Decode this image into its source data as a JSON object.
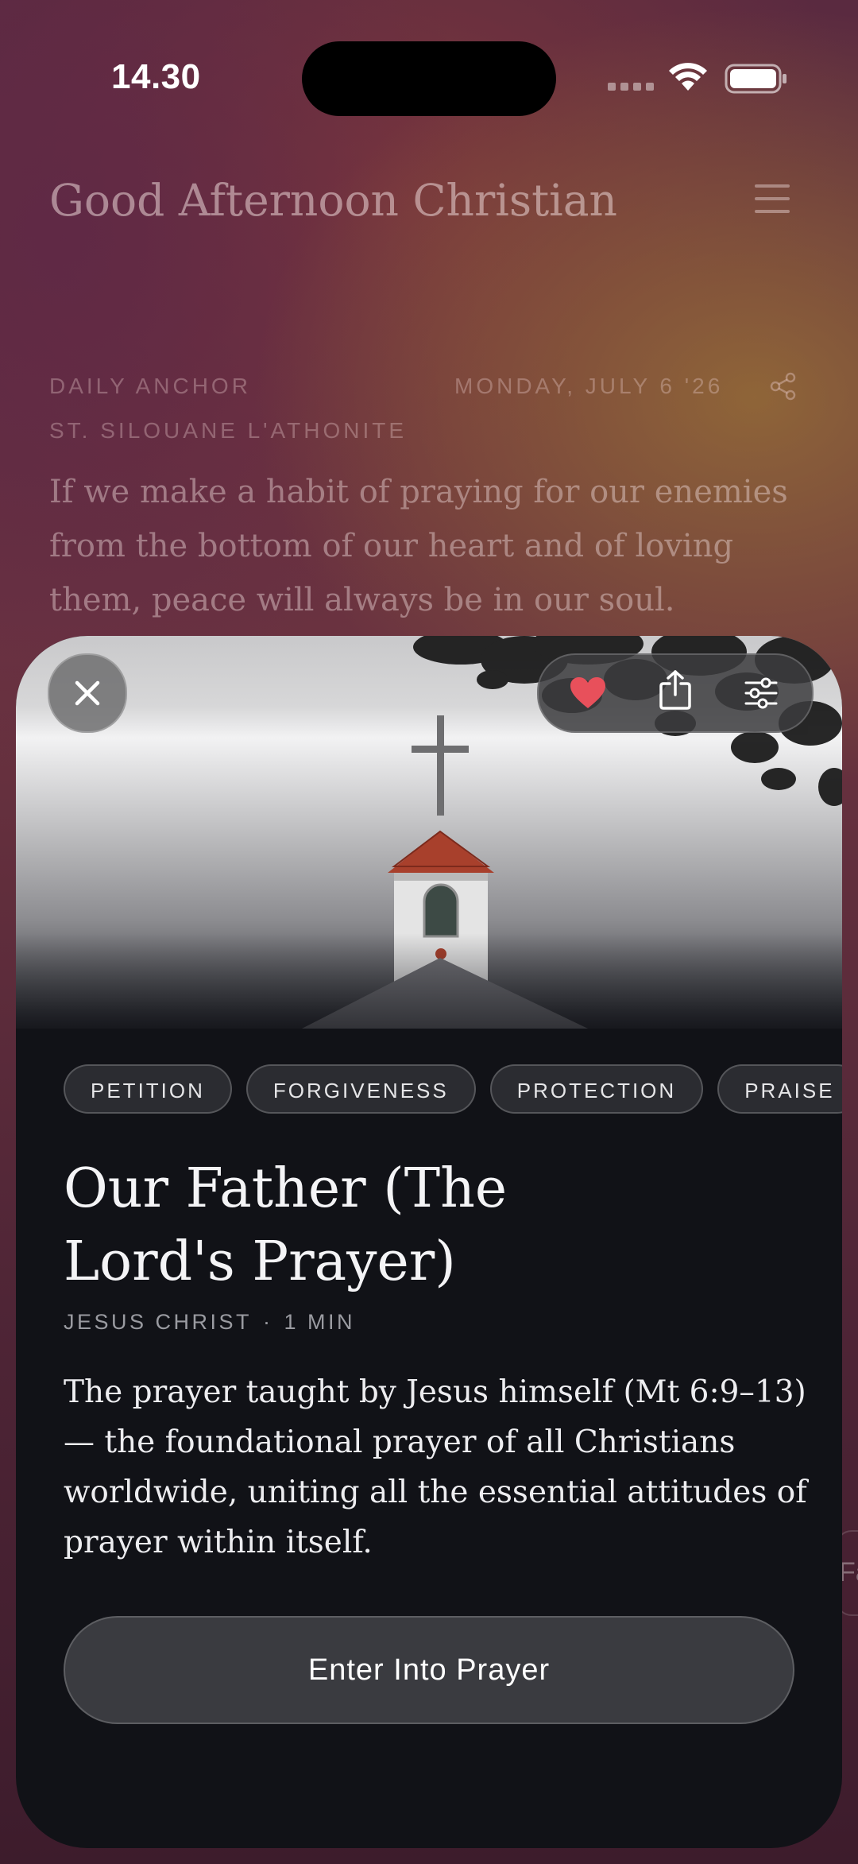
{
  "status_bar": {
    "time": "14.30"
  },
  "header": {
    "greeting": "Good Afternoon Christian"
  },
  "daily_anchor": {
    "label": "DAILY ANCHOR",
    "date": "MONDAY, JULY 6 '26",
    "author": "ST. SILOUANE L'ATHONITE",
    "quote": "If we make a habit of praying for our enemies from the bottom of our heart and of loving them, peace will always be in our soul."
  },
  "side_pill_text": "Fa",
  "prayer": {
    "tags": [
      "PETITION",
      "FORGIVENESS",
      "PROTECTION",
      "PRAISE"
    ],
    "title": "Our Father (The Lord's Prayer)",
    "author": "JESUS CHRIST",
    "separator": "·",
    "duration": "1 MIN",
    "description": "The prayer taught by Jesus himself (Mt 6:9–13) — the foundational prayer of all Christians worldwide, uniting all the essential attitudes of prayer within itself.",
    "cta_label": "Enter Into Prayer",
    "favorited": true
  },
  "icons": {
    "close": "close-icon",
    "favorite": "heart-icon",
    "share": "share-icon",
    "settings": "sliders-icon",
    "menu": "menu-icon",
    "share_small": "share-nodes-icon"
  },
  "colors": {
    "heart": "#e8505b",
    "sheet_bg": "#111217",
    "button_bg": "#3a3b40"
  }
}
